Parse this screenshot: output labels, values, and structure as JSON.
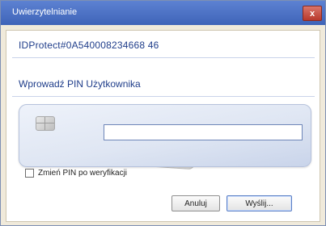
{
  "window": {
    "title": "Uwierzytelnianie",
    "close_label": "x"
  },
  "info": {
    "idprotect": "IDProtect#0A540008234668 46"
  },
  "prompt": {
    "text": "Wprowadź PIN Użytkownika"
  },
  "pin": {
    "value": "",
    "placeholder": ""
  },
  "options": {
    "change_pin_label": "Zmień PIN po weryfikacji",
    "change_pin_checked": false
  },
  "buttons": {
    "cancel_label": "Anuluj",
    "ok_label": "Wyślij..."
  },
  "colors": {
    "titlebar": "#3e64b8",
    "accent_text": "#1f3d8a",
    "close_button": "#b8392c"
  },
  "icons": {
    "card_chip": "smartcard-chip-icon"
  }
}
